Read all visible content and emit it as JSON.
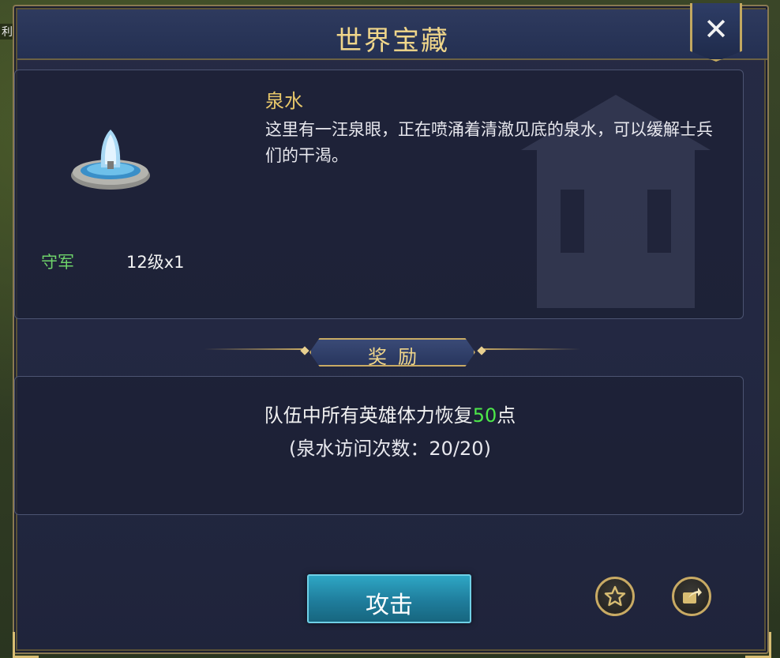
{
  "map": {
    "edge_label": "利"
  },
  "dialog": {
    "title": "世界宝藏",
    "close_symbol": "✕"
  },
  "treasure": {
    "name": "泉水",
    "description": "这里有一汪泉眼，正在喷涌着清澈见底的泉水，可以缓解士兵们的干渴。",
    "icon": "fountain-icon"
  },
  "garrison": {
    "label": "守军",
    "value": "12级x1"
  },
  "reward": {
    "header": "奖励",
    "text_before": "队伍中所有英雄体力恢复",
    "amount": "50",
    "text_after": "点",
    "visits": "(泉水访问次数：20/20)"
  },
  "actions": {
    "attack_label": "攻击",
    "favorite_icon": "star-icon",
    "share_icon": "share-icon"
  },
  "colors": {
    "gold": "#f0d68a",
    "green": "#6ed36a",
    "highlight": "#4de84a",
    "button": "#2ea6c4"
  }
}
